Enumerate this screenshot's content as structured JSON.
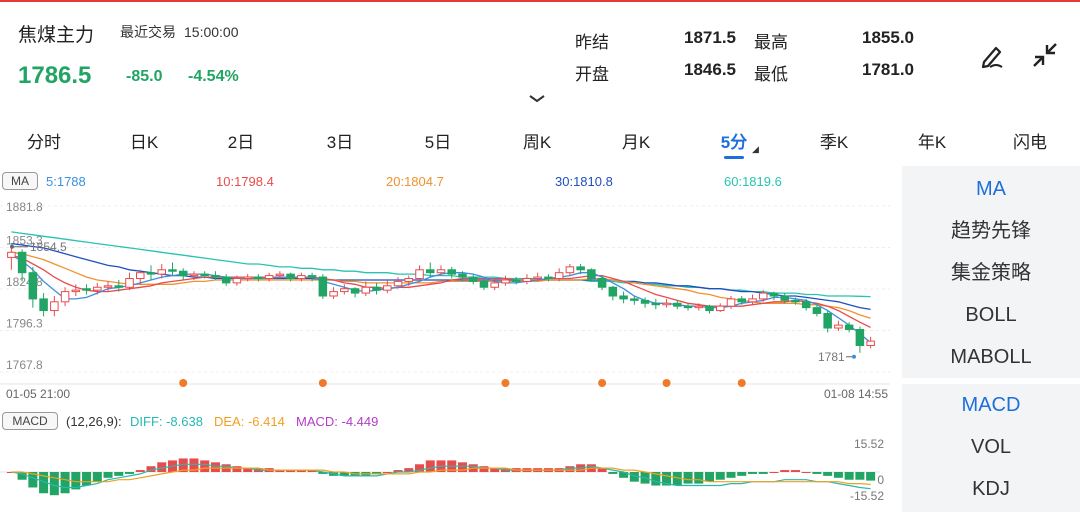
{
  "header": {
    "title": "焦煤主力",
    "session_label": "最近交易",
    "session_time": "15:00:00",
    "price": "1786.5",
    "change": "-85.0",
    "change_pct": "-4.54%",
    "stats": {
      "prev_settle_label": "昨结",
      "prev_settle": "1871.5",
      "high_label": "最高",
      "high": "1855.0",
      "open_label": "开盘",
      "open": "1846.5",
      "low_label": "最低",
      "low": "1781.0"
    }
  },
  "tabs": [
    "分时",
    "日K",
    "2日",
    "3日",
    "5日",
    "周K",
    "月K",
    "5分",
    "季K",
    "年K",
    "闪电"
  ],
  "active_tab": "5分",
  "ma_legend": {
    "tag": "MA",
    "items": [
      {
        "label": "5:1788",
        "color": "#3d8fe0"
      },
      {
        "label": "10:1798.4",
        "color": "#e84b4b"
      },
      {
        "label": "20:1804.7",
        "color": "#f0922e"
      },
      {
        "label": "30:1810.8",
        "color": "#1f4fbf"
      },
      {
        "label": "60:1819.6",
        "color": "#27c4b0"
      }
    ]
  },
  "macd_legend": {
    "tag": "MACD",
    "params": "(12,26,9):",
    "diff": "DIFF: -8.638",
    "dea": "DEA: -6.414",
    "macd": "MACD: -4.449",
    "diff_color": "#27b8b0",
    "dea_color": "#f0a020",
    "macd_color": "#b43cc8"
  },
  "indicators_main": [
    "MA",
    "趋势先锋",
    "集金策略",
    "BOLL",
    "MABOLL"
  ],
  "indicators_sub": [
    "MACD",
    "VOL",
    "KDJ"
  ],
  "active_main": "MA",
  "active_sub": "MACD",
  "chart_data": {
    "type": "candlestick",
    "y_ticks": [
      "1881.8",
      "1853.3",
      "1824.8",
      "1796.3",
      "1767.8"
    ],
    "ylim": [
      1767.8,
      1881.8
    ],
    "x_start": "01-05 21:00",
    "x_end": "01-08 14:55",
    "high_marker": "1854.5",
    "low_marker": "1781",
    "macd_ticks": [
      "15.52",
      "0",
      "-15.52"
    ],
    "candles": [
      {
        "o": 1846.5,
        "c": 1850,
        "h": 1855,
        "l": 1838
      },
      {
        "o": 1850,
        "c": 1836,
        "h": 1852,
        "l": 1830
      },
      {
        "o": 1836,
        "c": 1818,
        "h": 1840,
        "l": 1812
      },
      {
        "o": 1818,
        "c": 1810,
        "h": 1822,
        "l": 1806
      },
      {
        "o": 1810,
        "c": 1816,
        "h": 1820,
        "l": 1806
      },
      {
        "o": 1816,
        "c": 1823,
        "h": 1826,
        "l": 1813
      },
      {
        "o": 1823,
        "c": 1824,
        "h": 1828,
        "l": 1820
      },
      {
        "o": 1825,
        "c": 1824,
        "h": 1828,
        "l": 1821
      },
      {
        "o": 1824,
        "c": 1826,
        "h": 1829,
        "l": 1821
      },
      {
        "o": 1826,
        "c": 1827,
        "h": 1830,
        "l": 1823
      },
      {
        "o": 1827,
        "c": 1826,
        "h": 1831,
        "l": 1823
      },
      {
        "o": 1826,
        "c": 1832,
        "h": 1836,
        "l": 1824
      },
      {
        "o": 1832,
        "c": 1836,
        "h": 1838,
        "l": 1828
      },
      {
        "o": 1836,
        "c": 1835,
        "h": 1841,
        "l": 1831
      },
      {
        "o": 1835,
        "c": 1838,
        "h": 1842,
        "l": 1832
      },
      {
        "o": 1838,
        "c": 1837,
        "h": 1843,
        "l": 1834
      },
      {
        "o": 1837,
        "c": 1834,
        "h": 1839,
        "l": 1831
      },
      {
        "o": 1834,
        "c": 1835,
        "h": 1837,
        "l": 1831
      },
      {
        "o": 1835,
        "c": 1834,
        "h": 1837,
        "l": 1832
      },
      {
        "o": 1834,
        "c": 1833,
        "h": 1837,
        "l": 1831
      },
      {
        "o": 1833,
        "c": 1829,
        "h": 1835,
        "l": 1827
      },
      {
        "o": 1829,
        "c": 1832,
        "h": 1834,
        "l": 1827
      },
      {
        "o": 1832,
        "c": 1833,
        "h": 1835,
        "l": 1830
      },
      {
        "o": 1833,
        "c": 1832,
        "h": 1835,
        "l": 1830
      },
      {
        "o": 1832,
        "c": 1834,
        "h": 1836,
        "l": 1830
      },
      {
        "o": 1834,
        "c": 1835,
        "h": 1837,
        "l": 1832
      },
      {
        "o": 1835,
        "c": 1832,
        "h": 1836,
        "l": 1830
      },
      {
        "o": 1832,
        "c": 1834,
        "h": 1836,
        "l": 1830
      },
      {
        "o": 1834,
        "c": 1833,
        "h": 1836,
        "l": 1830
      },
      {
        "o": 1833,
        "c": 1820,
        "h": 1835,
        "l": 1818
      },
      {
        "o": 1820,
        "c": 1823,
        "h": 1826,
        "l": 1818
      },
      {
        "o": 1823,
        "c": 1825,
        "h": 1828,
        "l": 1821
      },
      {
        "o": 1825,
        "c": 1822,
        "h": 1826,
        "l": 1819
      },
      {
        "o": 1822,
        "c": 1826,
        "h": 1830,
        "l": 1820
      },
      {
        "o": 1826,
        "c": 1824,
        "h": 1829,
        "l": 1821
      },
      {
        "o": 1824,
        "c": 1827,
        "h": 1831,
        "l": 1822
      },
      {
        "o": 1827,
        "c": 1830,
        "h": 1833,
        "l": 1825
      },
      {
        "o": 1830,
        "c": 1832,
        "h": 1834,
        "l": 1827
      },
      {
        "o": 1832,
        "c": 1838,
        "h": 1841,
        "l": 1830
      },
      {
        "o": 1838,
        "c": 1836,
        "h": 1843,
        "l": 1833
      },
      {
        "o": 1836,
        "c": 1838,
        "h": 1841,
        "l": 1834
      },
      {
        "o": 1838,
        "c": 1835,
        "h": 1840,
        "l": 1832
      },
      {
        "o": 1835,
        "c": 1833,
        "h": 1837,
        "l": 1830
      },
      {
        "o": 1833,
        "c": 1830,
        "h": 1835,
        "l": 1828
      },
      {
        "o": 1830,
        "c": 1826,
        "h": 1832,
        "l": 1824
      },
      {
        "o": 1826,
        "c": 1829,
        "h": 1831,
        "l": 1824
      },
      {
        "o": 1829,
        "c": 1831,
        "h": 1834,
        "l": 1827
      },
      {
        "o": 1831,
        "c": 1830,
        "h": 1833,
        "l": 1828
      },
      {
        "o": 1830,
        "c": 1832,
        "h": 1835,
        "l": 1828
      },
      {
        "o": 1832,
        "c": 1833,
        "h": 1836,
        "l": 1830
      },
      {
        "o": 1833,
        "c": 1832,
        "h": 1835,
        "l": 1830
      },
      {
        "o": 1832,
        "c": 1836,
        "h": 1839,
        "l": 1830
      },
      {
        "o": 1836,
        "c": 1840,
        "h": 1842,
        "l": 1834
      },
      {
        "o": 1840,
        "c": 1838,
        "h": 1842,
        "l": 1835
      },
      {
        "o": 1838,
        "c": 1832,
        "h": 1839,
        "l": 1830
      },
      {
        "o": 1832,
        "c": 1826,
        "h": 1834,
        "l": 1824
      },
      {
        "o": 1826,
        "c": 1820,
        "h": 1827,
        "l": 1817
      },
      {
        "o": 1820,
        "c": 1818,
        "h": 1823,
        "l": 1815
      },
      {
        "o": 1818,
        "c": 1817,
        "h": 1820,
        "l": 1814
      },
      {
        "o": 1817,
        "c": 1815,
        "h": 1819,
        "l": 1812
      },
      {
        "o": 1815,
        "c": 1814,
        "h": 1818,
        "l": 1811
      },
      {
        "o": 1814,
        "c": 1815,
        "h": 1818,
        "l": 1812
      },
      {
        "o": 1815,
        "c": 1813,
        "h": 1817,
        "l": 1811
      },
      {
        "o": 1813,
        "c": 1812,
        "h": 1815,
        "l": 1810
      },
      {
        "o": 1812,
        "c": 1813,
        "h": 1815,
        "l": 1810
      },
      {
        "o": 1813,
        "c": 1810,
        "h": 1814,
        "l": 1808
      },
      {
        "o": 1810,
        "c": 1813,
        "h": 1815,
        "l": 1809
      },
      {
        "o": 1813,
        "c": 1818,
        "h": 1820,
        "l": 1811
      },
      {
        "o": 1818,
        "c": 1816,
        "h": 1820,
        "l": 1814
      },
      {
        "o": 1816,
        "c": 1818,
        "h": 1821,
        "l": 1814
      },
      {
        "o": 1818,
        "c": 1822,
        "h": 1824,
        "l": 1816
      },
      {
        "o": 1822,
        "c": 1820,
        "h": 1823,
        "l": 1817
      },
      {
        "o": 1820,
        "c": 1817,
        "h": 1822,
        "l": 1815
      },
      {
        "o": 1817,
        "c": 1816,
        "h": 1819,
        "l": 1814
      },
      {
        "o": 1816,
        "c": 1812,
        "h": 1818,
        "l": 1810
      },
      {
        "o": 1812,
        "c": 1808,
        "h": 1814,
        "l": 1806
      },
      {
        "o": 1808,
        "c": 1798,
        "h": 1810,
        "l": 1795
      },
      {
        "o": 1798,
        "c": 1800,
        "h": 1803,
        "l": 1796
      },
      {
        "o": 1800,
        "c": 1797,
        "h": 1802,
        "l": 1795
      },
      {
        "o": 1797,
        "c": 1786,
        "h": 1799,
        "l": 1781
      },
      {
        "o": 1786,
        "c": 1789,
        "h": 1792,
        "l": 1784
      }
    ],
    "ma5": [
      1848,
      1844,
      1838,
      1830,
      1824,
      1818,
      1818,
      1819,
      1822,
      1825,
      1826,
      1827,
      1829,
      1831,
      1833,
      1834,
      1835,
      1835,
      1835,
      1834,
      1833,
      1832,
      1832,
      1832,
      1832,
      1833,
      1833,
      1833,
      1833,
      1830,
      1828,
      1826,
      1824,
      1823,
      1824,
      1825,
      1826,
      1828,
      1830,
      1833,
      1835,
      1836,
      1836,
      1835,
      1833,
      1830,
      1829,
      1829,
      1830,
      1831,
      1832,
      1833,
      1834,
      1836,
      1836,
      1833,
      1829,
      1825,
      1820,
      1817,
      1815,
      1815,
      1814,
      1813,
      1813,
      1812,
      1812,
      1813,
      1815,
      1816,
      1817,
      1819,
      1819,
      1818,
      1817,
      1814,
      1810,
      1805,
      1800,
      1794,
      1788
    ],
    "ma10": [
      1848,
      1846,
      1842,
      1838,
      1833,
      1829,
      1826,
      1824,
      1823,
      1823,
      1824,
      1825,
      1826,
      1827,
      1829,
      1830,
      1831,
      1832,
      1833,
      1833,
      1833,
      1833,
      1833,
      1833,
      1833,
      1833,
      1833,
      1833,
      1833,
      1832,
      1831,
      1829,
      1828,
      1826,
      1826,
      1825,
      1826,
      1826,
      1827,
      1828,
      1829,
      1831,
      1832,
      1832,
      1832,
      1832,
      1832,
      1831,
      1831,
      1831,
      1832,
      1832,
      1832,
      1833,
      1834,
      1834,
      1832,
      1830,
      1827,
      1824,
      1821,
      1819,
      1817,
      1815,
      1814,
      1813,
      1813,
      1813,
      1813,
      1814,
      1815,
      1816,
      1816,
      1817,
      1816,
      1815,
      1813,
      1810,
      1806,
      1802,
      1798.4
    ],
    "ma20": [
      1850,
      1849,
      1847,
      1845,
      1842,
      1839,
      1836,
      1833,
      1831,
      1830,
      1829,
      1828,
      1828,
      1828,
      1828,
      1828,
      1829,
      1830,
      1830,
      1831,
      1831,
      1831,
      1831,
      1831,
      1831,
      1831,
      1831,
      1831,
      1831,
      1831,
      1831,
      1830,
      1830,
      1829,
      1829,
      1829,
      1829,
      1829,
      1829,
      1829,
      1830,
      1830,
      1830,
      1830,
      1830,
      1830,
      1830,
      1830,
      1830,
      1830,
      1831,
      1831,
      1831,
      1831,
      1832,
      1832,
      1831,
      1830,
      1829,
      1828,
      1827,
      1826,
      1825,
      1824,
      1822,
      1821,
      1819,
      1818,
      1817,
      1816,
      1815,
      1815,
      1815,
      1815,
      1814,
      1814,
      1813,
      1812,
      1810,
      1807,
      1804.7
    ],
    "ma30": [
      1856,
      1855,
      1854,
      1853,
      1851,
      1849,
      1847,
      1845,
      1843,
      1841,
      1840,
      1838,
      1837,
      1836,
      1835,
      1834,
      1834,
      1833,
      1833,
      1832,
      1832,
      1832,
      1832,
      1832,
      1832,
      1832,
      1832,
      1832,
      1832,
      1831,
      1831,
      1831,
      1831,
      1831,
      1831,
      1831,
      1831,
      1831,
      1831,
      1831,
      1831,
      1831,
      1831,
      1831,
      1831,
      1831,
      1831,
      1831,
      1831,
      1831,
      1831,
      1831,
      1831,
      1831,
      1831,
      1831,
      1831,
      1830,
      1830,
      1829,
      1829,
      1828,
      1827,
      1827,
      1826,
      1825,
      1825,
      1824,
      1823,
      1823,
      1822,
      1821,
      1820,
      1820,
      1819,
      1818,
      1817,
      1816,
      1814,
      1812,
      1810.8
    ],
    "ma60": [
      1864,
      1863,
      1862,
      1861,
      1860,
      1859,
      1858,
      1857,
      1856,
      1855,
      1854,
      1853,
      1852,
      1851,
      1850,
      1849,
      1848,
      1847,
      1846,
      1845,
      1844,
      1843,
      1842,
      1842,
      1841,
      1840,
      1840,
      1839,
      1839,
      1838,
      1838,
      1837,
      1837,
      1836,
      1836,
      1836,
      1835,
      1835,
      1835,
      1834,
      1834,
      1834,
      1833,
      1833,
      1833,
      1833,
      1832,
      1832,
      1832,
      1832,
      1831,
      1831,
      1831,
      1831,
      1830,
      1830,
      1830,
      1829,
      1829,
      1828,
      1828,
      1827,
      1827,
      1826,
      1826,
      1825,
      1825,
      1824,
      1824,
      1823,
      1823,
      1822,
      1822,
      1822,
      1821,
      1821,
      1820,
      1820,
      1820,
      1819.8,
      1819.6
    ],
    "macd_hist": [
      0,
      -4,
      -8,
      -11,
      -12,
      -11,
      -9,
      -7,
      -5,
      -3,
      -2,
      -1,
      1,
      3,
      5,
      6,
      7,
      7,
      6,
      5,
      4,
      3,
      2,
      2,
      2,
      1,
      1,
      1,
      1,
      -1,
      -2,
      -2,
      -2,
      -2,
      -1,
      0,
      1,
      2,
      4,
      6,
      6,
      6,
      5,
      4,
      3,
      2,
      2,
      2,
      2,
      2,
      2,
      2,
      3,
      4,
      4,
      2,
      -1,
      -3,
      -5,
      -6,
      -7,
      -7,
      -7,
      -6,
      -6,
      -5,
      -4,
      -3,
      -2,
      -1,
      -1,
      0,
      1,
      1,
      0,
      -1,
      -2,
      -3,
      -4,
      -4,
      -4.449
    ],
    "diff": [
      0,
      -1,
      -3,
      -5,
      -7,
      -8,
      -8,
      -7,
      -6,
      -4,
      -3,
      -2,
      -1,
      1,
      2,
      3,
      4,
      4,
      4,
      3,
      3,
      2,
      2,
      1,
      1,
      1,
      1,
      1,
      1,
      0,
      -1,
      -2,
      -2,
      -2,
      -2,
      -1,
      0,
      0,
      1,
      2,
      3,
      3,
      3,
      3,
      2,
      2,
      1,
      1,
      1,
      1,
      1,
      1,
      2,
      2,
      3,
      2,
      1,
      0,
      -2,
      -3,
      -5,
      -6,
      -7,
      -7,
      -7,
      -7,
      -7,
      -6,
      -6,
      -5,
      -5,
      -5,
      -4,
      -4,
      -4,
      -5,
      -5,
      -6,
      -7,
      -8,
      -8.638
    ],
    "dea": [
      0,
      0,
      -1,
      -2,
      -3,
      -4,
      -5,
      -5,
      -5,
      -5,
      -4,
      -4,
      -3,
      -2,
      -1,
      0,
      1,
      1,
      2,
      2,
      2,
      2,
      2,
      2,
      1,
      1,
      1,
      1,
      1,
      1,
      0,
      0,
      -1,
      -1,
      -1,
      -1,
      -1,
      -1,
      0,
      0,
      1,
      1,
      1,
      2,
      2,
      2,
      2,
      1,
      1,
      1,
      1,
      1,
      1,
      1,
      2,
      2,
      2,
      1,
      1,
      0,
      -1,
      -2,
      -3,
      -4,
      -4,
      -5,
      -5,
      -5,
      -5,
      -5,
      -5,
      -5,
      -5,
      -5,
      -5,
      -5,
      -5,
      -5,
      -6,
      -6,
      -6.414
    ]
  }
}
